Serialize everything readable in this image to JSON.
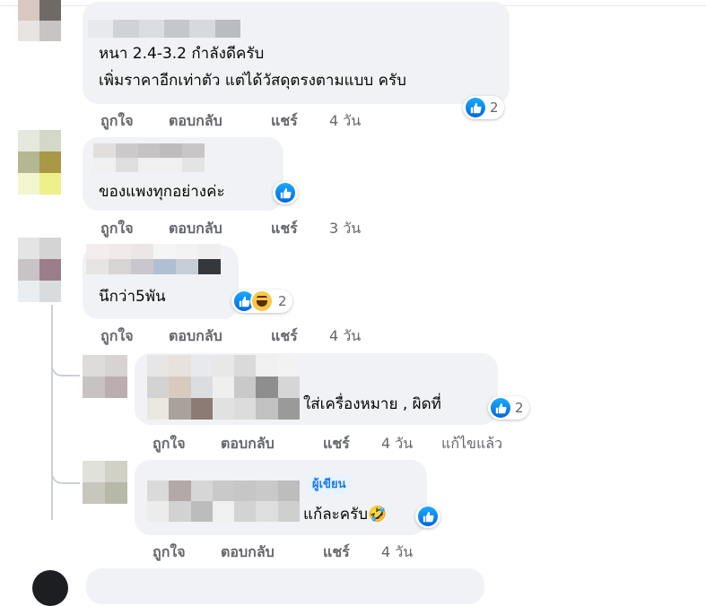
{
  "comments": [
    {
      "lines": [
        "หนา 2.4-3.2 กำลังดีครับ",
        "เพิ่มราคาอีกเท่าตัว แต่ได้วัสดุตรงตามแบบ ครับ"
      ],
      "reactions": {
        "icons": [
          "like-icon"
        ],
        "count": "2"
      },
      "actions": {
        "like": "ถูกใจ",
        "reply": "ตอบกลับ",
        "share": "แชร์",
        "time": "4 วัน"
      }
    },
    {
      "lines": [
        "ของแพงทุกอย่างค่ะ"
      ],
      "reactions": {
        "icons": [
          "like-icon"
        ],
        "count": ""
      },
      "actions": {
        "like": "ถูกใจ",
        "reply": "ตอบกลับ",
        "share": "แชร์",
        "time": "3 วัน"
      }
    },
    {
      "lines": [
        "นึกว่า5พัน"
      ],
      "reactions": {
        "icons": [
          "like-icon",
          "haha-icon"
        ],
        "count": "2"
      },
      "actions": {
        "like": "ถูกใจ",
        "reply": "ตอบกลับ",
        "share": "แชร์",
        "time": "4 วัน"
      }
    }
  ],
  "replies": [
    {
      "lines": [
        "ใส่เครื่องหมาย , ผิดที่"
      ],
      "reactions": {
        "icons": [
          "like-icon"
        ],
        "count": "2"
      },
      "actions": {
        "like": "ถูกใจ",
        "reply": "ตอบกลับ",
        "share": "แชร์",
        "time": "4 วัน",
        "edited": "แก้ไขแล้ว"
      }
    },
    {
      "author_badge": "ผู้เขียน",
      "lines": [
        "แก้ละครับ🤣"
      ],
      "reactions": {
        "icons": [
          "like-icon"
        ],
        "count": ""
      },
      "actions": {
        "like": "ถูกใจ",
        "reply": "ตอบกลับ",
        "share": "แชร์",
        "time": "4 วัน"
      }
    }
  ],
  "colors": {
    "bubble": "#f0f2f5",
    "action_text": "#65676b",
    "like_blue": "#1877f2",
    "author_badge_bg": "#e7f3ff"
  }
}
